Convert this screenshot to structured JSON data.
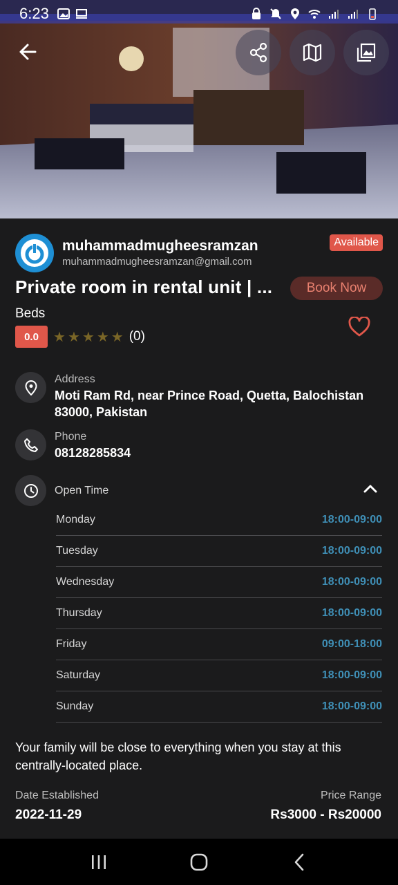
{
  "status_bar": {
    "time": "6:23"
  },
  "owner": {
    "name": "muhammadmugheesramzan",
    "email": "muhammadmugheesramzan@gmail.com",
    "badge": "Available"
  },
  "listing": {
    "title": "Private room in rental unit | ...",
    "book_label": "Book Now",
    "category": "Beds",
    "rating_score": "0.0",
    "rating_count": "(0)",
    "star_count": 5
  },
  "address": {
    "label": "Address",
    "value_line1": "Moti Ram Rd, near Prince Road, Quetta, Balochistan",
    "value_line2": "83000, Pakistan"
  },
  "phone": {
    "label": "Phone",
    "value": "08128285834"
  },
  "open_time": {
    "label": "Open Time",
    "days": [
      {
        "day": "Monday",
        "hours": "18:00-09:00"
      },
      {
        "day": "Tuesday",
        "hours": "18:00-09:00"
      },
      {
        "day": "Wednesday",
        "hours": "18:00-09:00"
      },
      {
        "day": "Thursday",
        "hours": "18:00-09:00"
      },
      {
        "day": "Friday",
        "hours": "09:00-18:00"
      },
      {
        "day": "Saturday",
        "hours": "18:00-09:00"
      },
      {
        "day": "Sunday",
        "hours": "18:00-09:00"
      }
    ]
  },
  "description": "Your family will be close to everything when you stay at this centrally-located place.",
  "meta": {
    "date_label": "Date Established",
    "date_value": "2022-11-29",
    "price_label": "Price Range",
    "price_value": "Rs3000 - Rs20000"
  },
  "colors": {
    "accent": "#e0574a",
    "hours_time": "#3f8fb6",
    "background": "#1b1b1c"
  }
}
